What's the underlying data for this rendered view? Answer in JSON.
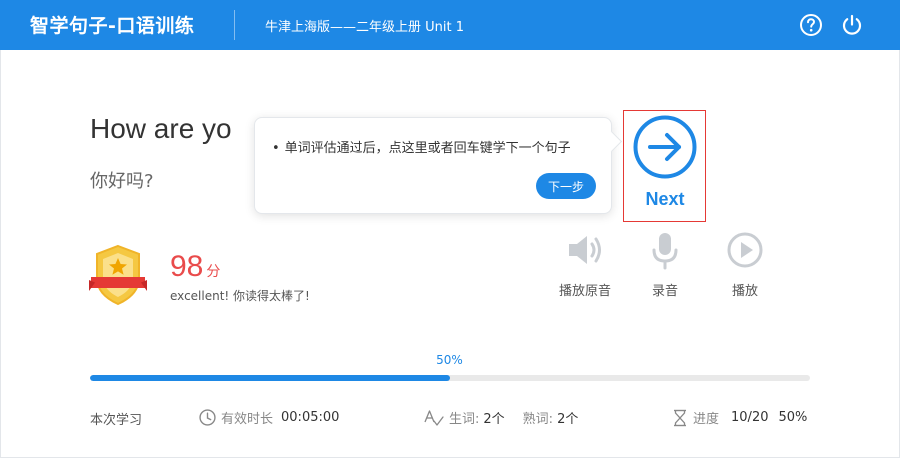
{
  "header": {
    "app_title": "智学句子-口语训练",
    "book_title": "牛津上海版——二年级上册 Unit 1",
    "help_icon": "help-circle-icon",
    "power_icon": "power-icon"
  },
  "sentence": {
    "english": "How are yo",
    "chinese": "你好吗?"
  },
  "tooltip": {
    "text": "单词评估通过后，点这里或者回车键学下一个句子",
    "button_label": "下一步"
  },
  "next": {
    "label": "Next",
    "icon": "arrow-right-circle-icon"
  },
  "score": {
    "value": "98",
    "unit": "分",
    "comment": "excellent! 你读得太棒了!"
  },
  "controls": [
    {
      "label": "播放原音",
      "icon": "speaker-icon"
    },
    {
      "label": "录音",
      "icon": "microphone-icon"
    },
    {
      "label": "播放",
      "icon": "play-circle-icon"
    }
  ],
  "progress": {
    "percent_label": "50%",
    "fraction": 0.5
  },
  "footer": {
    "title": "本次学习",
    "time_label": "有效时长",
    "time_value": "00:05:00",
    "new_words_label": "生词:",
    "new_words_value": "2个",
    "known_words_label": "熟词:",
    "known_words_value": "2个",
    "progress_label": "进度",
    "progress_count": "10/20",
    "progress_percent": "50%"
  },
  "colors": {
    "primary": "#1e88e5",
    "score": "#e94b4b",
    "highlight_border": "#e53935",
    "badge_gold": "#f5c842"
  }
}
